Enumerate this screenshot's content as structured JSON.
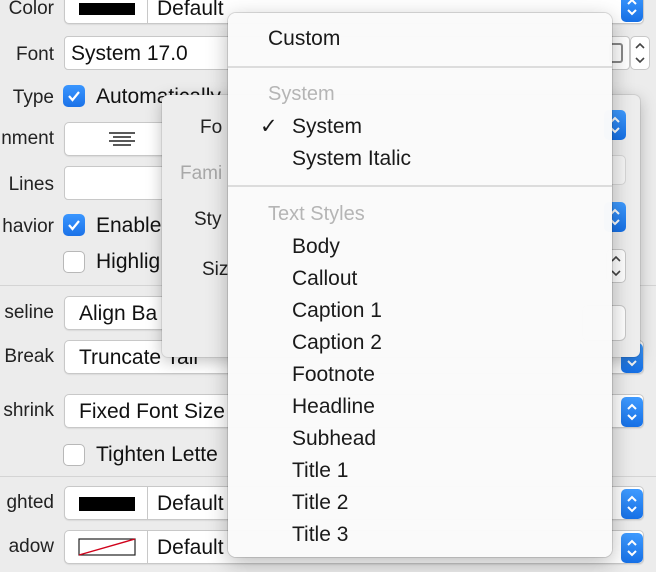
{
  "inspector": {
    "rows": {
      "color": {
        "label": "Color",
        "value": "Default"
      },
      "font": {
        "label": "Font",
        "value": "System 17.0"
      },
      "type": {
        "label": "Type",
        "checkbox_label": "Automatically"
      },
      "alignment": {
        "label": "nment"
      },
      "lines": {
        "label": "Lines"
      },
      "behavior": {
        "label": "havior",
        "enabled_label": "Enable",
        "highlighted_label": "Highlig"
      },
      "baseline": {
        "label": "seline",
        "value": "Align Ba"
      },
      "line_break": {
        "label": "Break",
        "value": "Truncate Tail"
      },
      "autoshrink": {
        "label": "shrink",
        "value": "Fixed Font Size",
        "tighten_label": "Tighten Lette"
      },
      "highlighted": {
        "label": "ghted",
        "value": "Default"
      },
      "shadow": {
        "label": "adow",
        "value": "Default"
      }
    }
  },
  "font_panel": {
    "font_label": "Fo",
    "family_label": "Fami",
    "style_label": "Sty",
    "size_label": "Siz"
  },
  "menu": {
    "custom": "Custom",
    "system_header": "System",
    "system_items": [
      {
        "label": "System",
        "checked": true
      },
      {
        "label": "System Italic",
        "checked": false
      }
    ],
    "text_styles_header": "Text Styles",
    "text_style_items": [
      "Body",
      "Callout",
      "Caption 1",
      "Caption 2",
      "Footnote",
      "Headline",
      "Subhead",
      "Title 1",
      "Title 2",
      "Title 3"
    ],
    "checkmark": "✓"
  },
  "colors": {
    "accent": "#1b72e8",
    "menu_header": "#b5b5b5"
  }
}
